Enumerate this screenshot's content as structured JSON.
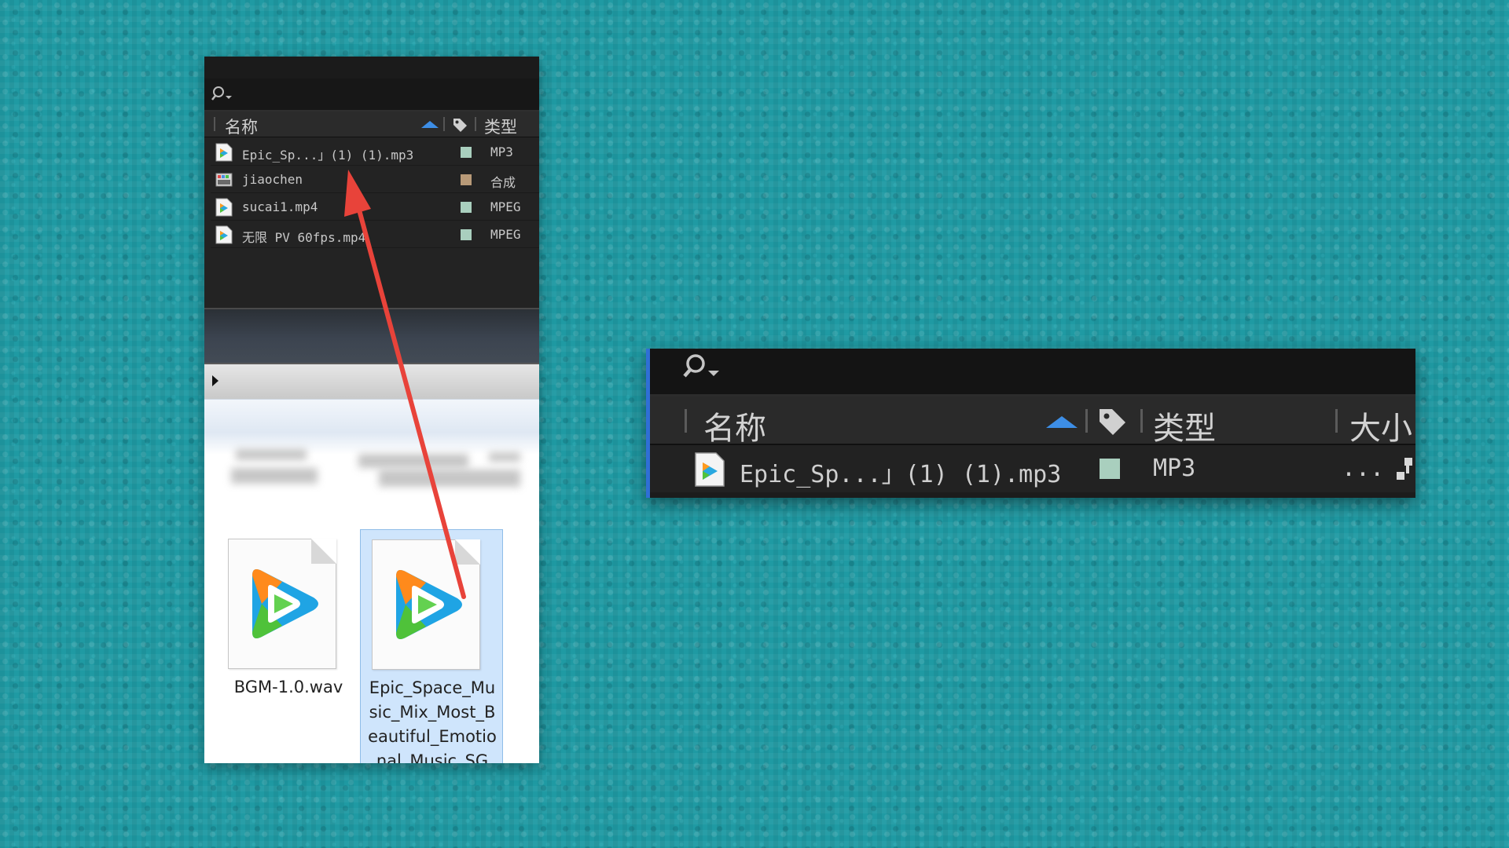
{
  "colors": {
    "background": "#1f9aa3",
    "panel_dark": "#232323",
    "sort_arrow": "#3d8ee6",
    "arrow": "#e8433a",
    "label_mp3": "#a9cfbe",
    "label_comp": "#b89a78",
    "label_mpeg": "#a9cfbe",
    "selection": "#cfe5fc"
  },
  "project_panel": {
    "columns": {
      "name": "名称",
      "type": "类型"
    },
    "items": [
      {
        "icon": "media-file-icon",
        "name": "Epic_Sp...」(1) (1).mp3",
        "type": "MP3",
        "label_color": "#a9cfbe"
      },
      {
        "icon": "composition-icon",
        "name": "jiaochen",
        "type": "合成",
        "label_color": "#b89a78"
      },
      {
        "icon": "media-file-icon",
        "name": "sucai1.mp4",
        "type": "MPEG",
        "label_color": "#a9cfbe"
      },
      {
        "icon": "media-file-icon",
        "name": "无限 PV 60fps.mp4",
        "type": "MPEG",
        "label_color": "#a9cfbe"
      }
    ]
  },
  "explorer": {
    "files": [
      {
        "name": "BGM-1.0.wav",
        "selected": false
      },
      {
        "name": "Epic_Space_Music_Mix_Most_Beautiful_Emotional_Music_SG_...",
        "selected": true
      }
    ]
  },
  "zoom_panel": {
    "columns": {
      "name": "名称",
      "type": "类型",
      "size": "大小"
    },
    "row": {
      "name": "Epic_Sp...」(1) (1).mp3",
      "type": "MP3",
      "size": "..."
    }
  }
}
